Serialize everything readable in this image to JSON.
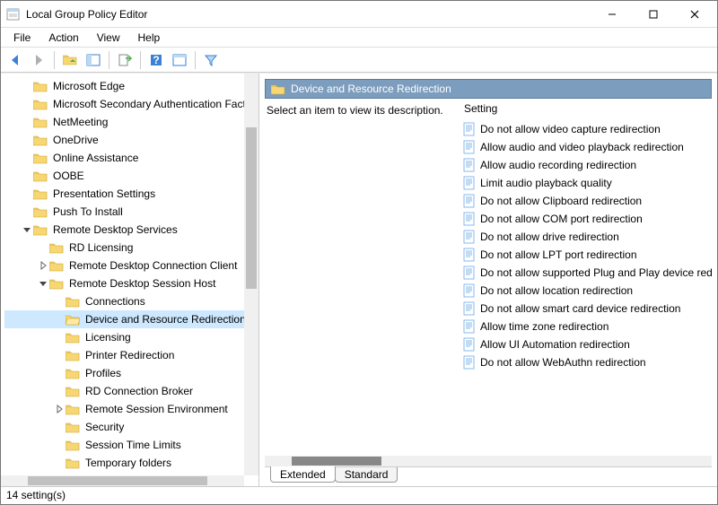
{
  "window": {
    "title": "Local Group Policy Editor"
  },
  "menu": {
    "file": "File",
    "action": "Action",
    "view": "View",
    "help": "Help"
  },
  "tree": {
    "items": [
      {
        "level": 1,
        "twisty": "",
        "label": "Microsoft Edge",
        "sel": false
      },
      {
        "level": 1,
        "twisty": "",
        "label": "Microsoft Secondary Authentication Factor",
        "sel": false
      },
      {
        "level": 1,
        "twisty": "",
        "label": "NetMeeting",
        "sel": false
      },
      {
        "level": 1,
        "twisty": "",
        "label": "OneDrive",
        "sel": false
      },
      {
        "level": 1,
        "twisty": "",
        "label": "Online Assistance",
        "sel": false
      },
      {
        "level": 1,
        "twisty": "",
        "label": "OOBE",
        "sel": false
      },
      {
        "level": 1,
        "twisty": "",
        "label": "Presentation Settings",
        "sel": false
      },
      {
        "level": 1,
        "twisty": "",
        "label": "Push To Install",
        "sel": false
      },
      {
        "level": 1,
        "twisty": "open",
        "label": "Remote Desktop Services",
        "sel": false
      },
      {
        "level": 2,
        "twisty": "",
        "label": "RD Licensing",
        "sel": false
      },
      {
        "level": 2,
        "twisty": "closed",
        "label": "Remote Desktop Connection Client",
        "sel": false
      },
      {
        "level": 2,
        "twisty": "open",
        "label": "Remote Desktop Session Host",
        "sel": false
      },
      {
        "level": 3,
        "twisty": "",
        "label": "Connections",
        "sel": false
      },
      {
        "level": 3,
        "twisty": "",
        "label": "Device and Resource Redirection",
        "sel": true
      },
      {
        "level": 3,
        "twisty": "",
        "label": "Licensing",
        "sel": false
      },
      {
        "level": 3,
        "twisty": "",
        "label": "Printer Redirection",
        "sel": false
      },
      {
        "level": 3,
        "twisty": "",
        "label": "Profiles",
        "sel": false
      },
      {
        "level": 3,
        "twisty": "",
        "label": "RD Connection Broker",
        "sel": false
      },
      {
        "level": 3,
        "twisty": "closed",
        "label": "Remote Session Environment",
        "sel": false
      },
      {
        "level": 3,
        "twisty": "",
        "label": "Security",
        "sel": false
      },
      {
        "level": 3,
        "twisty": "",
        "label": "Session Time Limits",
        "sel": false
      },
      {
        "level": 3,
        "twisty": "",
        "label": "Temporary folders",
        "sel": false
      }
    ]
  },
  "right": {
    "header": "Device and Resource Redirection",
    "desc": "Select an item to view its description.",
    "colSetting": "Setting",
    "items": [
      "Do not allow video capture redirection",
      "Allow audio and video playback redirection",
      "Allow audio recording redirection",
      "Limit audio playback quality",
      "Do not allow Clipboard redirection",
      "Do not allow COM port redirection",
      "Do not allow drive redirection",
      "Do not allow LPT port redirection",
      "Do not allow supported Plug and Play device redirection",
      "Do not allow location redirection",
      "Do not allow smart card device redirection",
      "Allow time zone redirection",
      "Allow UI Automation redirection",
      "Do not allow WebAuthn redirection"
    ]
  },
  "tabs": {
    "extended": "Extended",
    "standard": "Standard"
  },
  "status": {
    "text": "14 setting(s)"
  }
}
